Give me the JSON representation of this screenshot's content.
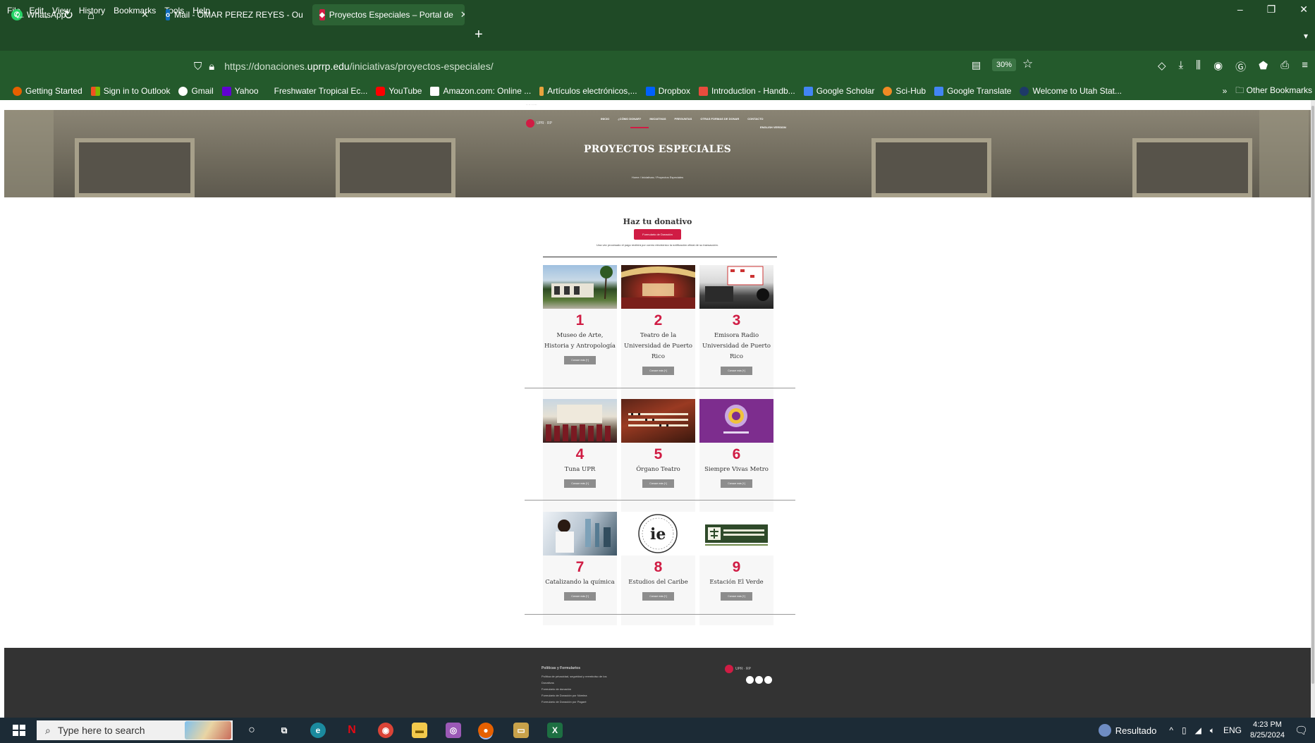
{
  "menu": [
    "File",
    "Edit",
    "View",
    "History",
    "Bookmarks",
    "Tools",
    "Help"
  ],
  "window_controls": {
    "minimize": "–",
    "restore": "❐",
    "close": "✕"
  },
  "tabs": [
    {
      "title": "WhatsApp",
      "icon_color": "#25d366"
    },
    {
      "title": "Mail - OMAR PEREZ REYES - Ou",
      "icon_color": "#0f6cbd"
    },
    {
      "title": "Proyectos Especiales – Portal de",
      "icon_color": "#d01c44"
    }
  ],
  "new_tab": "+",
  "url": {
    "prefix": "https://donaciones.",
    "domain": "uprrp.edu",
    "path": "/iniciativas/proyectos-especiales/"
  },
  "zoom": "30%",
  "bookmarks": [
    {
      "label": "Getting Started",
      "color": "#e66000"
    },
    {
      "label": "Sign in to Outlook",
      "color": "#f25022"
    },
    {
      "label": "Gmail",
      "color": "#ffffff"
    },
    {
      "label": "Yahoo",
      "color": "#6001d2"
    },
    {
      "label": "Freshwater Tropical Ec...",
      "color": "#245a2c"
    },
    {
      "label": "YouTube",
      "color": "#ff0000"
    },
    {
      "label": "Amazon.com: Online ...",
      "color": "#ffffff"
    },
    {
      "label": "Artículos electrónicos,...",
      "color": "#e8a33d"
    },
    {
      "label": "Dropbox",
      "color": "#0061fe"
    },
    {
      "label": "Introduction - Handb...",
      "color": "#e84c3d"
    },
    {
      "label": "Google Scholar",
      "color": "#4285f4"
    },
    {
      "label": "Sci-Hub",
      "color": "#f08a24"
    },
    {
      "label": "Google Translate",
      "color": "#4285f4"
    },
    {
      "label": "Welcome to Utah Stat...",
      "color": "#1e3a68"
    }
  ],
  "other_bookmarks": "Other Bookmarks",
  "page": {
    "nav": [
      "INICIO",
      "¿CÓMO DONAR?",
      "INICIATIVAS",
      "PREGUNTAS",
      "OTRAS FORMAS DE DONAR",
      "CONTACTO"
    ],
    "nav_sub": "ENGLISH VERSION",
    "title": "PROYECTOS ESPECIALES",
    "breadcrumb": "Home / Iniciativas / Proyectos Especiales",
    "donate_heading": "Haz tu donativo",
    "donate_button": "Formulario de Donación",
    "donate_note": "Una vez procesado el pago recibirá por correo electrónico la notificación oficial de su transacción.",
    "card_button": "Conoce más [+]",
    "projects": [
      {
        "num": "1",
        "title": "Museo de Arte, Historia y Antropología"
      },
      {
        "num": "2",
        "title": "Teatro de la Universidad de Puerto Rico"
      },
      {
        "num": "3",
        "title": "Emisora Radio Universidad de Puerto Rico"
      },
      {
        "num": "4",
        "title": "Tuna UPR"
      },
      {
        "num": "5",
        "title": "Órgano Teatro"
      },
      {
        "num": "6",
        "title": "Siempre Vivas Metro"
      },
      {
        "num": "7",
        "title": "Catalizando la química"
      },
      {
        "num": "8",
        "title": "Estudios del Caribe"
      },
      {
        "num": "9",
        "title": "Estación El Verde"
      }
    ],
    "footer_title": "Políticas y Formularios",
    "footer_links": [
      "Política de privacidad, seguridad y reembolso de los",
      "Donativos",
      "Formulario de donación",
      "Formulario de Donación por Nómina",
      "Formulario de Donación por Pagaré"
    ]
  },
  "taskbar": {
    "search_placeholder": "Type here to search",
    "tray_app": "Resultado",
    "language": "ENG",
    "time": "4:23 PM",
    "date": "8/25/2024"
  }
}
